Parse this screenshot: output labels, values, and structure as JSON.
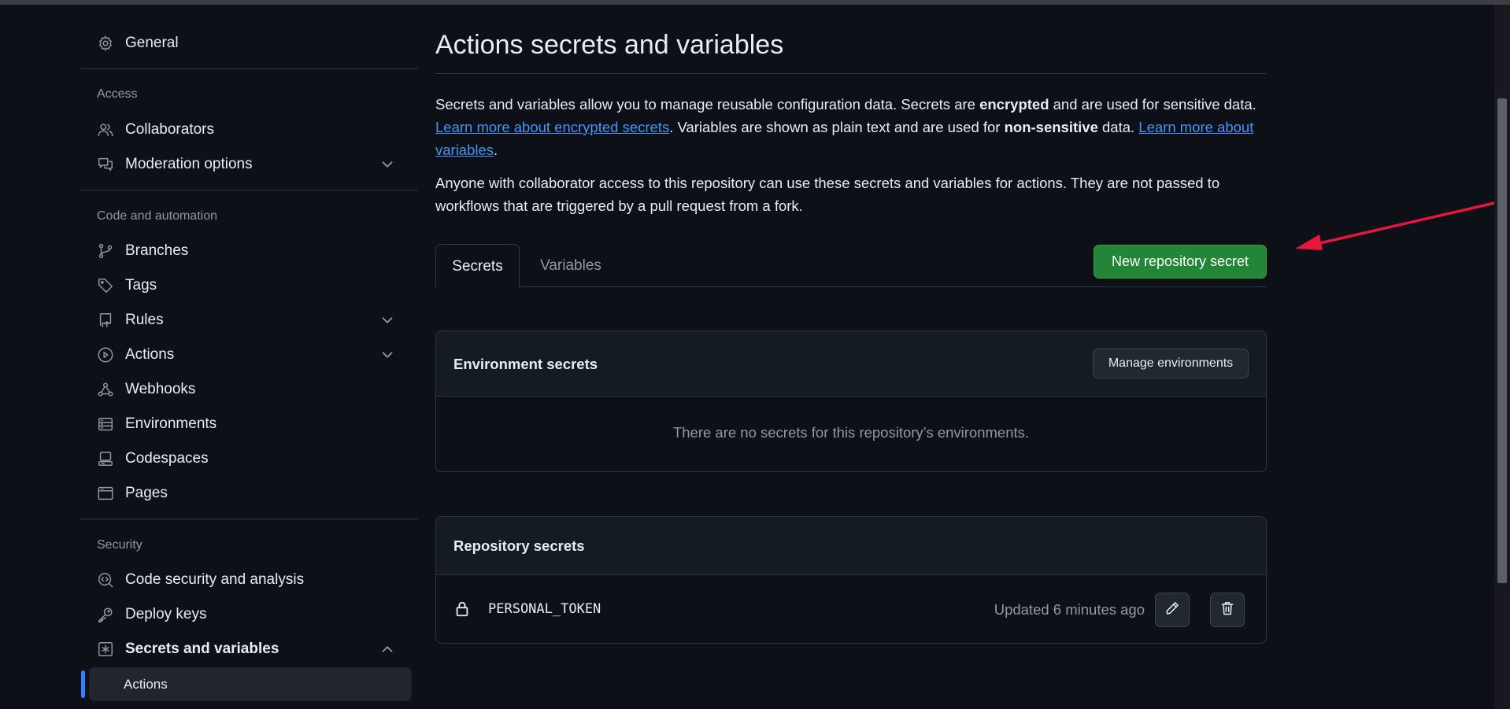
{
  "sidebar": {
    "general": "General",
    "access_title": "Access",
    "collaborators": "Collaborators",
    "moderation": "Moderation options",
    "code_automation_title": "Code and automation",
    "branches": "Branches",
    "tags": "Tags",
    "rules": "Rules",
    "actions": "Actions",
    "webhooks": "Webhooks",
    "environments": "Environments",
    "codespaces": "Codespaces",
    "pages": "Pages",
    "security_title": "Security",
    "code_security": "Code security and analysis",
    "deploy_keys": "Deploy keys",
    "secrets_variables": "Secrets and variables",
    "sub_actions": "Actions"
  },
  "main": {
    "title": "Actions secrets and variables",
    "p1_a": "Secrets and variables allow you to manage reusable configuration data. Secrets are ",
    "p1_b": "encrypted",
    "p1_c": " and are used for sensitive data. ",
    "p1_link1": "Learn more about encrypted secrets",
    "p1_d": ". Variables are shown as plain text and are used for ",
    "p1_e": "non-sensitive",
    "p1_f": " data. ",
    "p1_link2": "Learn more about variables",
    "p1_g": ".",
    "p2": "Anyone with collaborator access to this repository can use these secrets and variables for actions. They are not passed to workflows that are triggered by a pull request from a fork.",
    "tabs": [
      {
        "label": "Secrets",
        "active": true
      },
      {
        "label": "Variables",
        "active": false
      }
    ],
    "new_secret_button": "New repository secret",
    "env_box": {
      "title": "Environment secrets",
      "manage_button": "Manage environments",
      "empty": "There are no secrets for this repository’s environments."
    },
    "repo_box": {
      "title": "Repository secrets",
      "secrets": [
        {
          "name": "PERSONAL_TOKEN",
          "updated": "Updated 6 minutes ago"
        }
      ]
    }
  },
  "colors": {
    "background": "#0d1117",
    "primary_button": "#238636",
    "link": "#4493f8",
    "annotation_arrow": "#e8163c"
  }
}
